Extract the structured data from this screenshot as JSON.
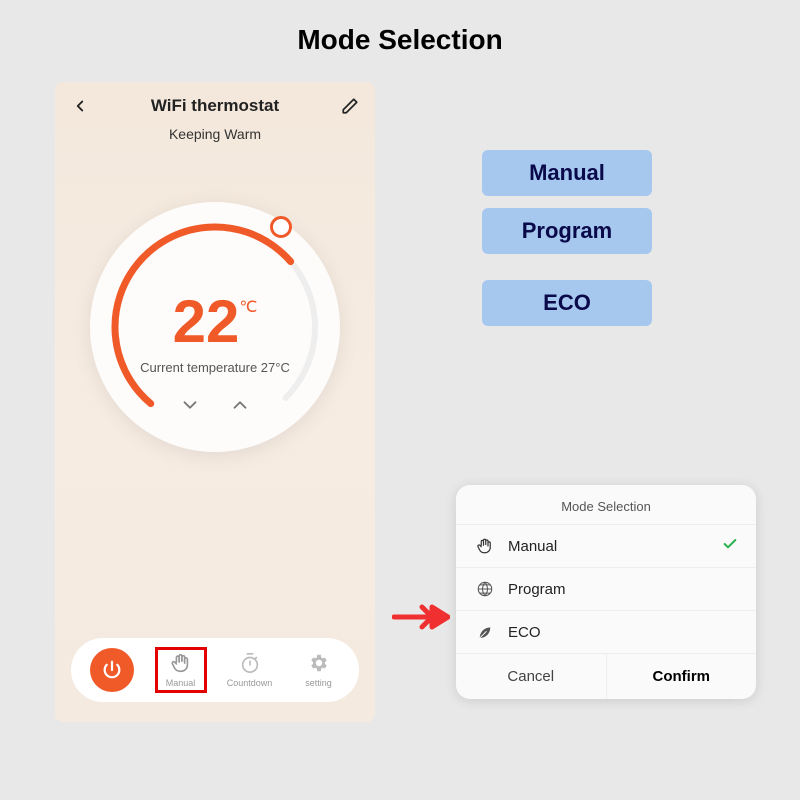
{
  "title": "Mode Selection",
  "phone": {
    "title": "WiFi thermostat",
    "status": "Keeping Warm",
    "set_temp": "22",
    "unit": "℃",
    "current_temp_label": "Current temperature 27°C",
    "bottom": {
      "power": "",
      "manual": "Manual",
      "countdown": "Countdown",
      "setting": "setting"
    }
  },
  "chips": {
    "manual": "Manual",
    "program": "Program",
    "eco": "ECO"
  },
  "popup": {
    "title": "Mode Selection",
    "items": {
      "manual": "Manual",
      "program": "Program",
      "eco": "ECO"
    },
    "selected": "manual",
    "cancel": "Cancel",
    "confirm": "Confirm"
  }
}
